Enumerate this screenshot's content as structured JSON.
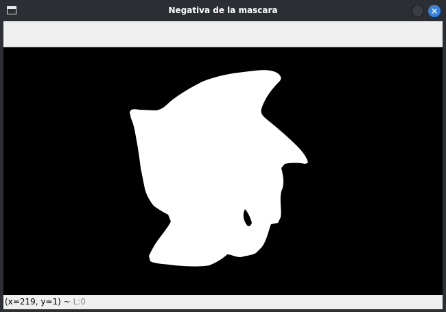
{
  "window": {
    "title": "Negativa de la mascara",
    "close_glyph": "×",
    "icons": {
      "app": "window-icon",
      "minimize": "minimize-icon",
      "close": "close-icon"
    }
  },
  "image": {
    "description": "binary mask: white silhouette on black background"
  },
  "status": {
    "coords": "(x=219, y=1)",
    "separator": " ~ ",
    "level": "L:0"
  },
  "colors": {
    "titlebar": "#2b2e33",
    "close_button": "#3584e4",
    "toolbar": "#efefef",
    "canvas": "#000000",
    "mask": "#ffffff"
  }
}
